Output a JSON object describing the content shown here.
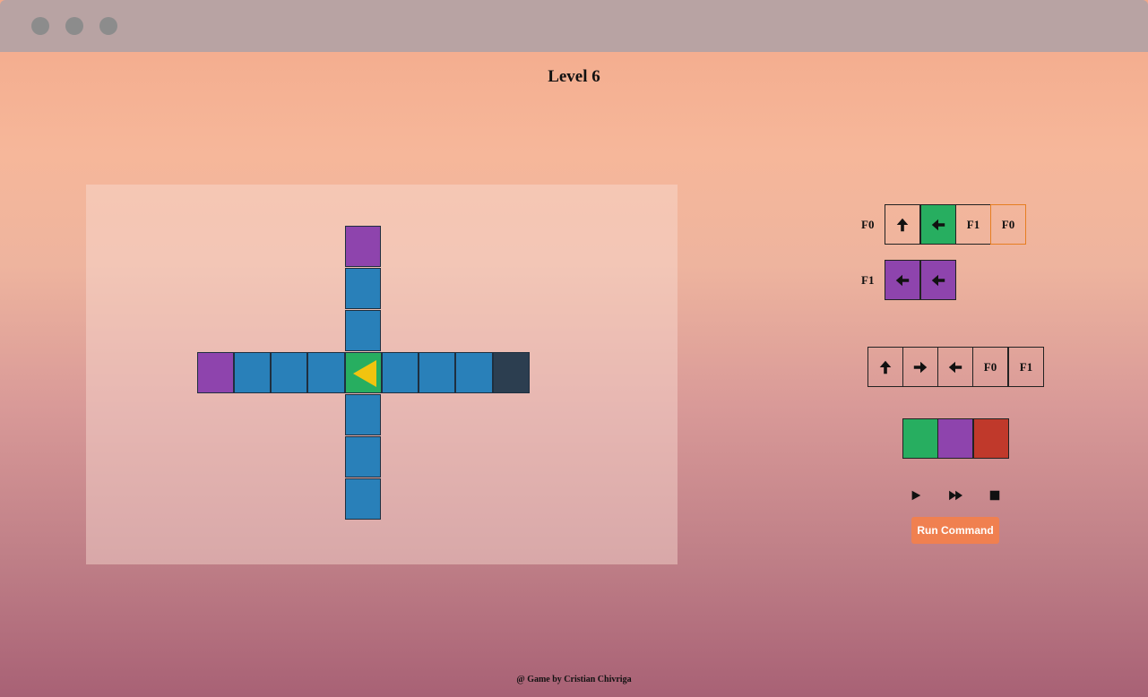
{
  "window": {
    "dots": [
      "close",
      "minimize",
      "maximize"
    ],
    "titlebar_color": "#b8a3a3"
  },
  "game": {
    "title": "Level 6",
    "footer": "@ Game by Cristian Chivriga",
    "robot_direction": "left"
  },
  "colors": {
    "blue": "#2980b9",
    "purple": "#8e44ad",
    "green": "#27ae60",
    "dark": "#2c3e50",
    "red": "#c0392b",
    "robot": "#f1c40f",
    "run_button": "#f08050"
  },
  "functions": {
    "f0": {
      "label": "F0",
      "slots": [
        {
          "kind": "arrow",
          "icon": "arrow-up-icon",
          "color": "none"
        },
        {
          "kind": "arrow",
          "icon": "arrow-left-icon",
          "color": "green"
        },
        {
          "kind": "call",
          "text": "F1",
          "color": "none"
        },
        {
          "kind": "call",
          "text": "F0",
          "color": "none"
        }
      ]
    },
    "f1": {
      "label": "F1",
      "slots": [
        {
          "kind": "arrow",
          "icon": "arrow-left-icon",
          "color": "purple"
        },
        {
          "kind": "arrow",
          "icon": "arrow-left-icon",
          "color": "purple"
        }
      ]
    }
  },
  "palette": {
    "commands": [
      {
        "icon": "arrow-up-icon"
      },
      {
        "icon": "arrow-right-icon"
      },
      {
        "icon": "arrow-left-icon"
      },
      {
        "text": "F0"
      },
      {
        "text": "F1"
      }
    ],
    "colors": [
      "green",
      "purple",
      "red"
    ]
  },
  "controls": {
    "play_icon": "play-icon",
    "fast_forward_icon": "fast-forward-icon",
    "stop_icon": "stop-icon",
    "run_label": "Run Command"
  }
}
